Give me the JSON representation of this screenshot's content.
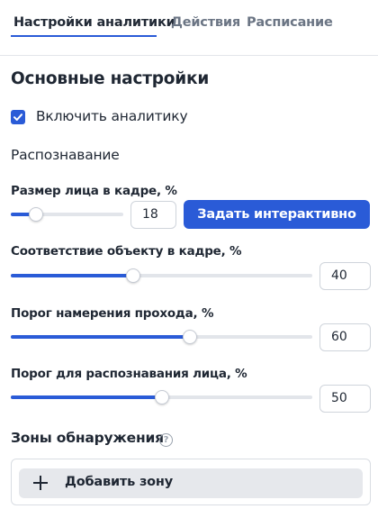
{
  "tabs": [
    {
      "label": "Настройки аналитики",
      "active": true
    },
    {
      "label": "Действия",
      "active": false
    },
    {
      "label": "Расписание",
      "active": false
    }
  ],
  "section_title": "Основные настройки",
  "enable_analytics": {
    "label": "Включить аналитику",
    "checked": true
  },
  "recognition_title": "Распознавание",
  "face_size": {
    "label": "Размер лица в кадре, %",
    "value": "18",
    "button_label": "Задать интерактивно"
  },
  "object_match": {
    "label": "Соответствие объекту в кадре, %",
    "value": "40"
  },
  "pass_intent": {
    "label": "Порог намерения прохода, %",
    "value": "60"
  },
  "face_threshold": {
    "label": "Порог для распознавания лица, %",
    "value": "50"
  },
  "zones": {
    "title": "Зоны обнаружения",
    "add_label": "Добавить зону"
  },
  "colors": {
    "accent": "#2a5bd7",
    "text": "#1f2733",
    "muted": "#6b7584"
  },
  "icons": {
    "check": "check-icon",
    "help": "help-icon",
    "plus": "plus-icon"
  }
}
